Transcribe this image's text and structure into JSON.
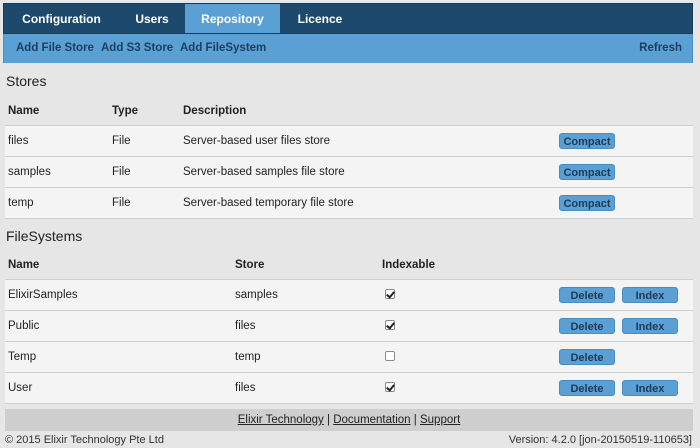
{
  "nav": {
    "tabs": [
      {
        "label": "Configuration",
        "active": false
      },
      {
        "label": "Users",
        "active": false
      },
      {
        "label": "Repository",
        "active": true
      },
      {
        "label": "Licence",
        "active": false
      }
    ],
    "active_color": "#5aa0d4",
    "bar_color": "#1d4a6c"
  },
  "subnav": {
    "links": [
      "Add File Store",
      "Add S3 Store",
      "Add FileSystem"
    ],
    "refresh": "Refresh"
  },
  "stores": {
    "title": "Stores",
    "headers": [
      "Name",
      "Type",
      "Description"
    ],
    "rows": [
      {
        "name": "files",
        "type": "File",
        "description": "Server-based user files store",
        "action": "Compact"
      },
      {
        "name": "samples",
        "type": "File",
        "description": "Server-based samples file store",
        "action": "Compact"
      },
      {
        "name": "temp",
        "type": "File",
        "description": "Server-based temporary file store",
        "action": "Compact"
      }
    ]
  },
  "filesystems": {
    "title": "FileSystems",
    "headers": [
      "Name",
      "Store",
      "Indexable"
    ],
    "rows": [
      {
        "name": "ElixirSamples",
        "store": "samples",
        "indexable": true,
        "delete": "Delete",
        "index": "Index"
      },
      {
        "name": "Public",
        "store": "files",
        "indexable": true,
        "delete": "Delete",
        "index": "Index"
      },
      {
        "name": "Temp",
        "store": "temp",
        "indexable": false,
        "delete": "Delete",
        "index": ""
      },
      {
        "name": "User",
        "store": "files",
        "indexable": true,
        "delete": "Delete",
        "index": "Index"
      }
    ]
  },
  "footer": {
    "links": [
      "Elixir Technology",
      "Documentation",
      "Support"
    ],
    "separator": "|",
    "copyright": "© 2015 Elixir Technology Pte Ltd",
    "version": "Version: 4.2.0 [jon-20150519-110653]"
  }
}
